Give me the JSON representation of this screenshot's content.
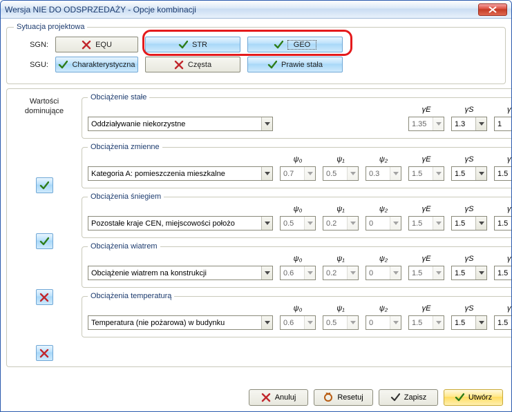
{
  "window": {
    "title": "Wersja NIE DO ODSPRZEDAŻY - Opcje kombinacji"
  },
  "situation": {
    "legend": "Sytuacja projektowa",
    "sgn_label": "SGN:",
    "sgu_label": "SGU:",
    "sgn": {
      "equ": "EQU",
      "str": "STR",
      "geo": "GEO"
    },
    "sgu": {
      "char": "Charakterystyczna",
      "czesta": "Częsta",
      "prawie": "Prawie stała"
    }
  },
  "dominant": {
    "line1": "Wartości",
    "line2": "dominujące"
  },
  "headers": {
    "psi0": "ψ₀",
    "psi1": "ψ₁",
    "psi2": "ψ₂",
    "gE": "γE",
    "gS": "γS",
    "gG": "γG"
  },
  "groups": {
    "stale": {
      "legend": "Obciążenie stałe",
      "combo": "Oddziaływanie niekorzystne",
      "gE": "1.35",
      "gS": "1.3",
      "gG": "1"
    },
    "zmienne": {
      "legend": "Obciążenia zmienne",
      "combo": "Kategoria A: pomieszczenia mieszkalne",
      "psi0": "0.7",
      "psi1": "0.5",
      "psi2": "0.3",
      "gE": "1.5",
      "gS": "1.5",
      "gG": "1.5"
    },
    "snieg": {
      "legend": "Obciążenia śniegiem",
      "combo": "Pozostałe kraje CEN, miejscowości położo",
      "psi0": "0.5",
      "psi1": "0.2",
      "psi2": "0",
      "gE": "1.5",
      "gS": "1.5",
      "gG": "1.5"
    },
    "wiatr": {
      "legend": "Obciążenia wiatrem",
      "combo": "Obciążenie wiatrem na konstrukcji",
      "psi0": "0.6",
      "psi1": "0.2",
      "psi2": "0",
      "gE": "1.5",
      "gS": "1.5",
      "gG": "1.5"
    },
    "temp": {
      "legend": "Obciążenia temperaturą",
      "combo": "Temperatura (nie pożarowa) w budynku",
      "psi0": "0.6",
      "psi1": "0.5",
      "psi2": "0",
      "gE": "1.5",
      "gS": "1.5",
      "gG": "1.5"
    }
  },
  "footer": {
    "anuluj": "Anuluj",
    "resetuj": "Resetuj",
    "zapisz": "Zapisz",
    "utworz": "Utwórz"
  }
}
